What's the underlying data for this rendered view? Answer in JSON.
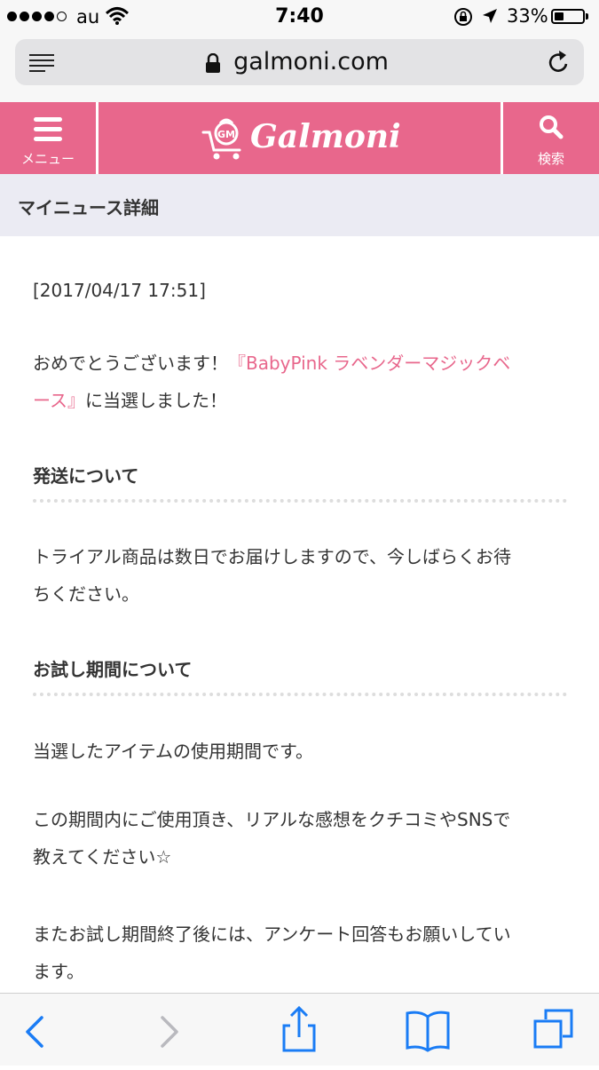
{
  "status_bar": {
    "carrier": "au",
    "time": "7:40",
    "battery_percent": "33%",
    "battery_level": 0.33,
    "signal_bars_filled": 4,
    "signal_bars_total": 5
  },
  "browser": {
    "url": "galmoni.com"
  },
  "site_header": {
    "menu_label": "メニュー",
    "logo_text": "Galmoni",
    "logo_badge": "GM",
    "search_label": "検索",
    "color": "#e8678c"
  },
  "page": {
    "title": "マイニュース詳細",
    "timestamp": "[2017/04/17 17:51]",
    "congrats_prefix": "おめでとうございます！",
    "product_link_line1": "『BabyPink ラベンダーマジックベ",
    "product_link_line2": "ース』",
    "congrats_suffix": "に当選しました！",
    "sections": [
      {
        "heading": "発送について",
        "paragraphs": [
          [
            "トライアル商品は数日でお届けしますので、今しばらくお待",
            "ちください。"
          ]
        ]
      },
      {
        "heading": "お試し期間について",
        "paragraphs": [
          [
            "当選したアイテムの使用期間です。"
          ],
          [
            "この期間内にご使用頂き、リアルな感想をクチコミやSNSで",
            "教えてください☆"
          ],
          [
            "またお試し期間終了後には、アンケート回答もお願いしてい",
            "ます。"
          ]
        ]
      }
    ]
  },
  "toolbar": {
    "icons": [
      "back-icon",
      "forward-icon",
      "share-icon",
      "bookmarks-icon",
      "tabs-icon"
    ],
    "accent": "#1a7cf5"
  }
}
